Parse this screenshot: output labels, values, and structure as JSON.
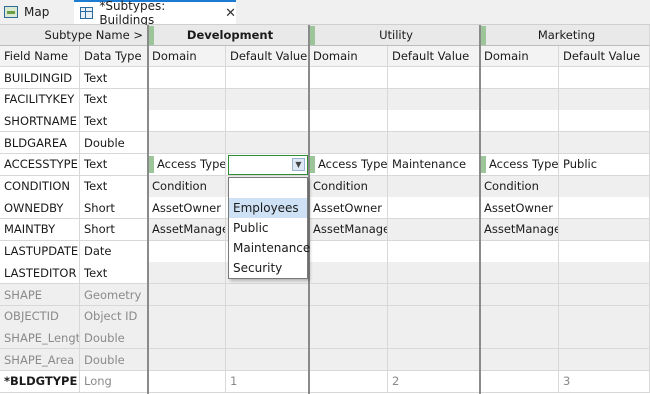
{
  "tabs": [
    {
      "label": "Map",
      "icon": "map-icon",
      "active": false
    },
    {
      "label": "*Subtypes:  Buildings",
      "icon": "table-icon",
      "active": true
    }
  ],
  "header": {
    "subtype_name_label": "Subtype Name >",
    "groups": [
      "Development",
      "Utility",
      "Marketing"
    ],
    "field_name": "Field Name",
    "data_type": "Data Type",
    "domain": "Domain",
    "default_value": "Default Value"
  },
  "rows": [
    {
      "field": "BUILDINGID",
      "type": "Text",
      "muted": false,
      "bold": false,
      "dev_domain": "",
      "dev_default": "",
      "util_domain": "",
      "util_default": "",
      "mkt_domain": "",
      "mkt_default": ""
    },
    {
      "field": "FACILITYKEY",
      "type": "Text",
      "muted": false,
      "bold": false,
      "dev_domain": "",
      "dev_default": "",
      "util_domain": "",
      "util_default": "",
      "mkt_domain": "",
      "mkt_default": ""
    },
    {
      "field": "SHORTNAME",
      "type": "Text",
      "muted": false,
      "bold": false,
      "dev_domain": "",
      "dev_default": "",
      "util_domain": "",
      "util_default": "",
      "mkt_domain": "",
      "mkt_default": ""
    },
    {
      "field": "BLDGAREA",
      "type": "Double",
      "muted": false,
      "bold": false,
      "dev_domain": "",
      "dev_default": "",
      "util_domain": "",
      "util_default": "",
      "mkt_domain": "",
      "mkt_default": ""
    },
    {
      "field": "ACCESSTYPE",
      "type": "Text",
      "muted": false,
      "bold": false,
      "dev_domain": "Access Type",
      "dev_default": "",
      "util_domain": "Access Type",
      "util_default": "Maintenance",
      "mkt_domain": "Access Type",
      "mkt_default": "Public"
    },
    {
      "field": "CONDITION",
      "type": "Text",
      "muted": false,
      "bold": false,
      "dev_domain": "Condition",
      "dev_default": "",
      "util_domain": "Condition",
      "util_default": "",
      "mkt_domain": "Condition",
      "mkt_default": ""
    },
    {
      "field": "OWNEDBY",
      "type": "Short",
      "muted": false,
      "bold": false,
      "dev_domain": "AssetOwner",
      "dev_default": "",
      "util_domain": "AssetOwner",
      "util_default": "",
      "mkt_domain": "AssetOwner",
      "mkt_default": ""
    },
    {
      "field": "MAINTBY",
      "type": "Short",
      "muted": false,
      "bold": false,
      "dev_domain": "AssetManager",
      "dev_default": "",
      "util_domain": "AssetManager",
      "util_default": "",
      "mkt_domain": "AssetManager",
      "mkt_default": ""
    },
    {
      "field": "LASTUPDATE",
      "type": "Date",
      "muted": false,
      "bold": false,
      "dev_domain": "",
      "dev_default": "",
      "util_domain": "",
      "util_default": "",
      "mkt_domain": "",
      "mkt_default": ""
    },
    {
      "field": "LASTEDITOR",
      "type": "Text",
      "muted": false,
      "bold": false,
      "dev_domain": "",
      "dev_default": "",
      "util_domain": "",
      "util_default": "",
      "mkt_domain": "",
      "mkt_default": ""
    },
    {
      "field": "SHAPE",
      "type": "Geometry",
      "muted": true,
      "bold": false,
      "dev_domain": "",
      "dev_default": "",
      "util_domain": "",
      "util_default": "",
      "mkt_domain": "",
      "mkt_default": ""
    },
    {
      "field": "OBJECTID",
      "type": "Object ID",
      "muted": true,
      "bold": false,
      "dev_domain": "",
      "dev_default": "",
      "util_domain": "",
      "util_default": "",
      "mkt_domain": "",
      "mkt_default": ""
    },
    {
      "field": "SHAPE_Length",
      "type": "Double",
      "muted": true,
      "bold": false,
      "dev_domain": "",
      "dev_default": "",
      "util_domain": "",
      "util_default": "",
      "mkt_domain": "",
      "mkt_default": ""
    },
    {
      "field": "SHAPE_Area",
      "type": "Double",
      "muted": true,
      "bold": false,
      "dev_domain": "",
      "dev_default": "",
      "util_domain": "",
      "util_default": "",
      "mkt_domain": "",
      "mkt_default": ""
    },
    {
      "field": "*BLDGTYPE",
      "type": "Long",
      "muted": false,
      "bold": true,
      "dev_domain": "",
      "dev_default": "1",
      "util_domain": "",
      "util_default": "2",
      "mkt_domain": "",
      "mkt_default": "3"
    }
  ],
  "dropdown": {
    "current_value": "",
    "options": [
      "",
      "Employees",
      "Public",
      "Maintenance",
      "Security"
    ],
    "highlighted": "Employees"
  },
  "colors": {
    "group_marker": "#9cc59a",
    "active_edit_border": "#2e8b2e",
    "selection": "#cfe2f5",
    "tab_accent": "#1e7bd2"
  }
}
